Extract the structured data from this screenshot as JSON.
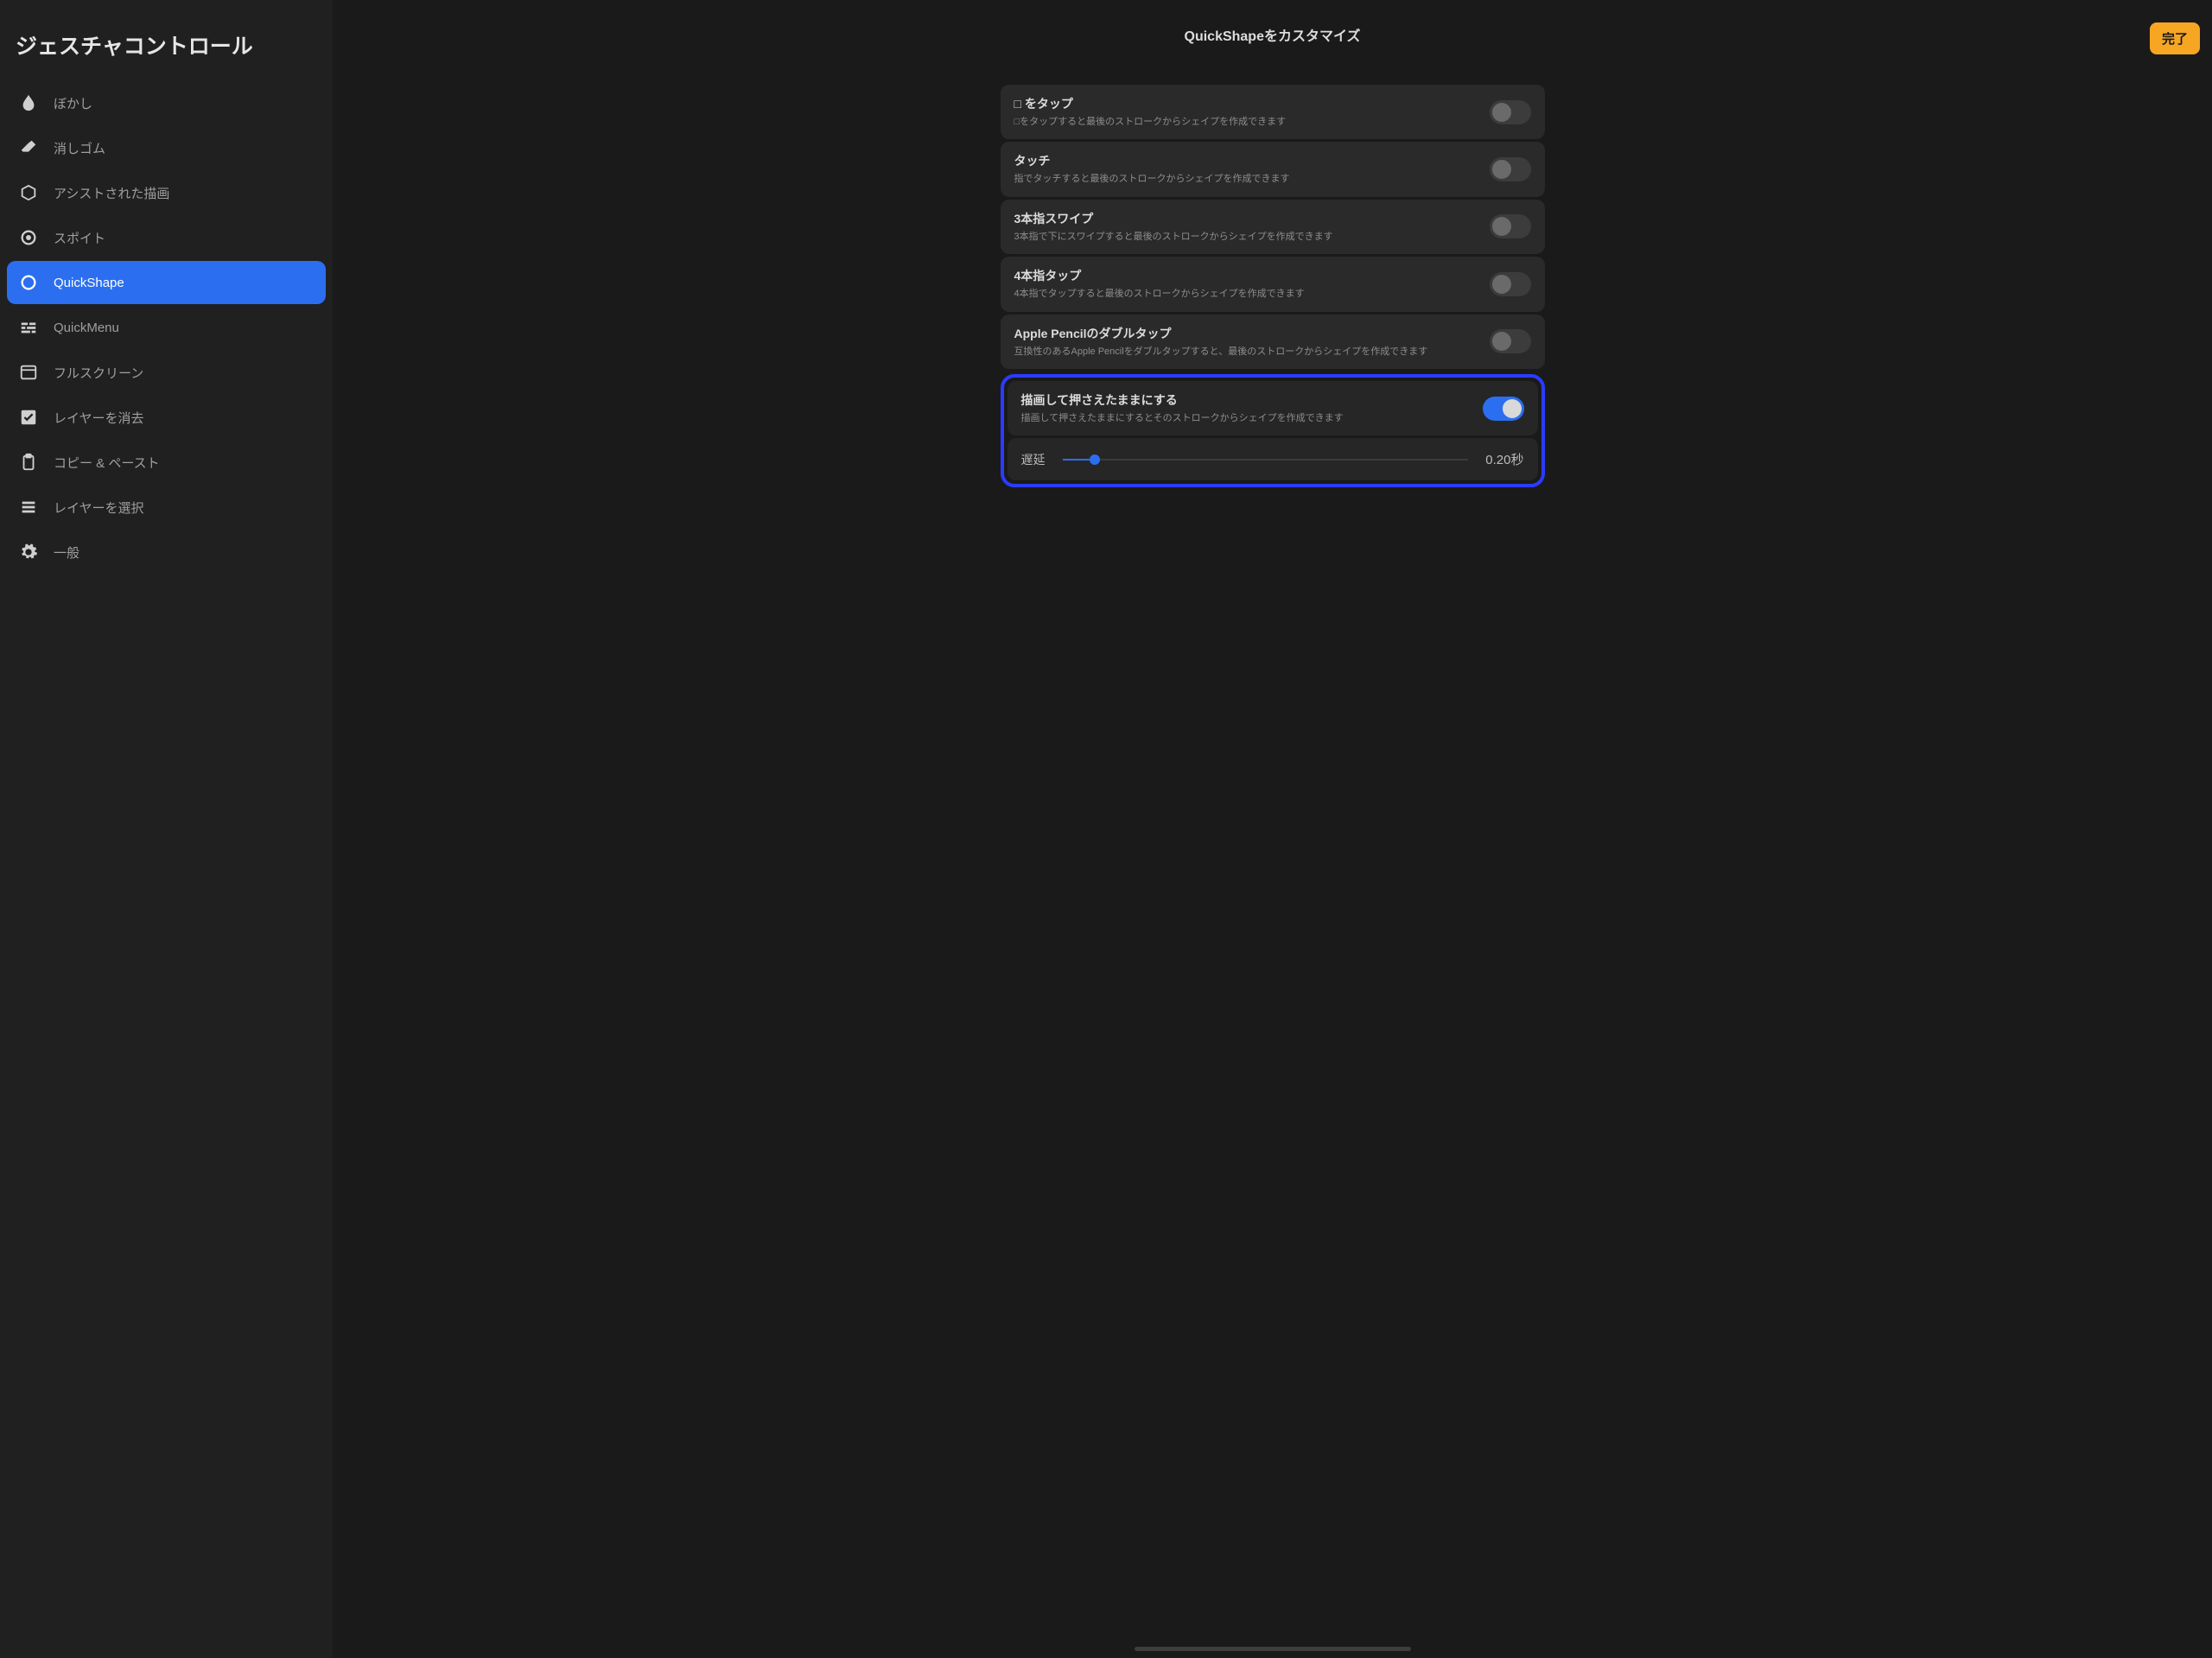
{
  "sidebar": {
    "title": "ジェスチャコントロール",
    "items": [
      {
        "icon": "blur-icon",
        "label": "ぼかし"
      },
      {
        "icon": "eraser-icon",
        "label": "消しゴム"
      },
      {
        "icon": "cube-icon",
        "label": "アシストされた描画"
      },
      {
        "icon": "target-icon",
        "label": "スポイト"
      },
      {
        "icon": "ring-icon",
        "label": "QuickShape",
        "selected": true
      },
      {
        "icon": "menu-lines-icon",
        "label": "QuickMenu"
      },
      {
        "icon": "window-icon",
        "label": "フルスクリーン"
      },
      {
        "icon": "checkbox-icon",
        "label": "レイヤーを消去"
      },
      {
        "icon": "clipboard-icon",
        "label": "コピー & ペースト"
      },
      {
        "icon": "stack-icon",
        "label": "レイヤーを選択"
      },
      {
        "icon": "gear-icon",
        "label": "一般"
      }
    ]
  },
  "header": {
    "title": "QuickShapeをカスタマイズ",
    "done": "完了"
  },
  "settings": [
    {
      "title": "□ をタップ",
      "desc": "□をタップすると最後のストロークからシェイプを作成できます",
      "on": false
    },
    {
      "title": "タッチ",
      "desc": "指でタッチすると最後のストロークからシェイプを作成できます",
      "on": false
    },
    {
      "title": "3本指スワイプ",
      "desc": "3本指で下にスワイプすると最後のストロークからシェイプを作成できます",
      "on": false
    },
    {
      "title": "4本指タップ",
      "desc": "4本指でタップすると最後のストロークからシェイプを作成できます",
      "on": false
    },
    {
      "title": "Apple Pencilのダブルタップ",
      "desc": "互換性のあるApple Pencilをダブルタップすると、最後のストロークからシェイプを作成できます",
      "on": false
    }
  ],
  "highlighted": {
    "title": "描画して押さえたままにする",
    "desc": "描画して押さえたままにするとそのストロークからシェイプを作成できます",
    "on": true,
    "delay_label": "遅延",
    "delay_value": "0.20秒",
    "delay_percent": 8
  }
}
